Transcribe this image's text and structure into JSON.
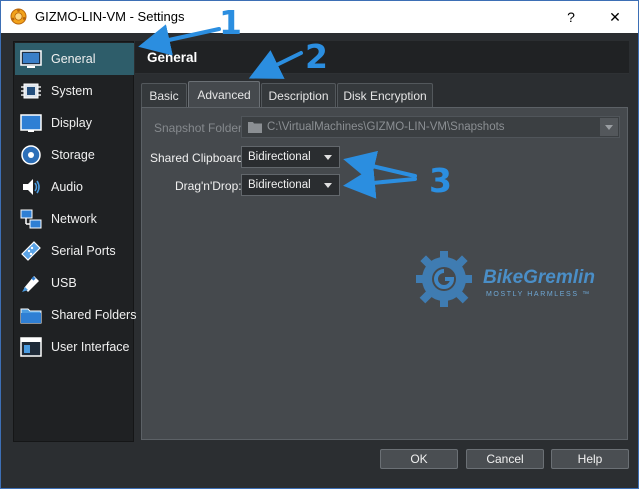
{
  "window": {
    "title": "GIZMO-LIN-VM - Settings",
    "help_glyph": "?",
    "close_glyph": "✕"
  },
  "sidebar": {
    "items": [
      {
        "label": "General",
        "icon": "general-icon",
        "active": true
      },
      {
        "label": "System",
        "icon": "system-icon"
      },
      {
        "label": "Display",
        "icon": "display-icon"
      },
      {
        "label": "Storage",
        "icon": "storage-icon"
      },
      {
        "label": "Audio",
        "icon": "audio-icon"
      },
      {
        "label": "Network",
        "icon": "network-icon"
      },
      {
        "label": "Serial Ports",
        "icon": "serial-ports-icon"
      },
      {
        "label": "USB",
        "icon": "usb-icon"
      },
      {
        "label": "Shared Folders",
        "icon": "shared-folders-icon"
      },
      {
        "label": "User Interface",
        "icon": "user-interface-icon"
      }
    ]
  },
  "main": {
    "title": "General",
    "tabs": [
      {
        "label": "Basic"
      },
      {
        "label": "Advanced",
        "active": true
      },
      {
        "label": "Description"
      },
      {
        "label": "Disk Encryption"
      }
    ],
    "advanced": {
      "snapshot_folder_label": "Snapshot Folder:",
      "snapshot_folder_value": "C:\\VirtualMachines\\GIZMO-LIN-VM\\Snapshots",
      "shared_clipboard_label": "Shared Clipboard:",
      "shared_clipboard_value": "Bidirectional",
      "drag_n_drop_label": "Drag'n'Drop:",
      "drag_n_drop_value": "Bidirectional"
    }
  },
  "watermark": {
    "name": "BikeGremlin",
    "tagline": "MOSTLY HARMLESS ™"
  },
  "buttons": {
    "ok": "OK",
    "cancel": "Cancel",
    "help": "Help"
  },
  "annotations": [
    "1",
    "2",
    "3"
  ],
  "colors": {
    "accent_blue": "#2b8ee0",
    "active_item": "#2e5d6a",
    "panel_bg": "#45494d"
  }
}
